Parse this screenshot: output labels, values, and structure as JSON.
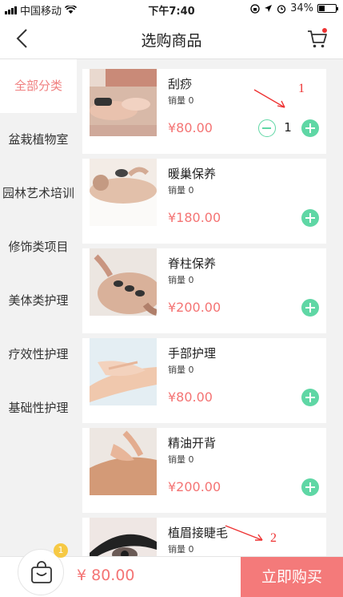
{
  "status_bar": {
    "carrier": "中国移动",
    "time": "下午7:40",
    "battery": "34%",
    "battery_level": 0.34
  },
  "header": {
    "title": "选购商品",
    "back_icon": "chevron-left-icon",
    "cart_icon": "cart-icon"
  },
  "sidebar": {
    "items": [
      {
        "label": "全部分类",
        "active": true
      },
      {
        "label": "盆栽植物室",
        "active": false
      },
      {
        "label": "园林艺术培训",
        "active": false
      },
      {
        "label": "修饰类项目",
        "active": false
      },
      {
        "label": "美体类护理",
        "active": false
      },
      {
        "label": "疗效性护理",
        "active": false
      },
      {
        "label": "基础性护理",
        "active": false
      }
    ]
  },
  "products": [
    {
      "name": "刮痧",
      "sales": "销量 0",
      "price": "¥80.00",
      "quantity": "1"
    },
    {
      "name": "暖巢保养",
      "sales": "销量 0",
      "price": "¥180.00"
    },
    {
      "name": "脊柱保养",
      "sales": "销量 0",
      "price": "¥200.00"
    },
    {
      "name": "手部护理",
      "sales": "销量 0",
      "price": "¥80.00"
    },
    {
      "name": "精油开背",
      "sales": "销量 0",
      "price": "¥200.00"
    },
    {
      "name": "植眉接睫毛",
      "sales": "销量 0"
    }
  ],
  "annotations": {
    "one": "1",
    "two": "2"
  },
  "bottom_bar": {
    "cart_badge": "1",
    "total": "¥ 80.00",
    "buy_label": "立即购买"
  },
  "colors": {
    "accent": "#f47474",
    "green": "#5fd7a5",
    "badge": "#f6c944"
  }
}
